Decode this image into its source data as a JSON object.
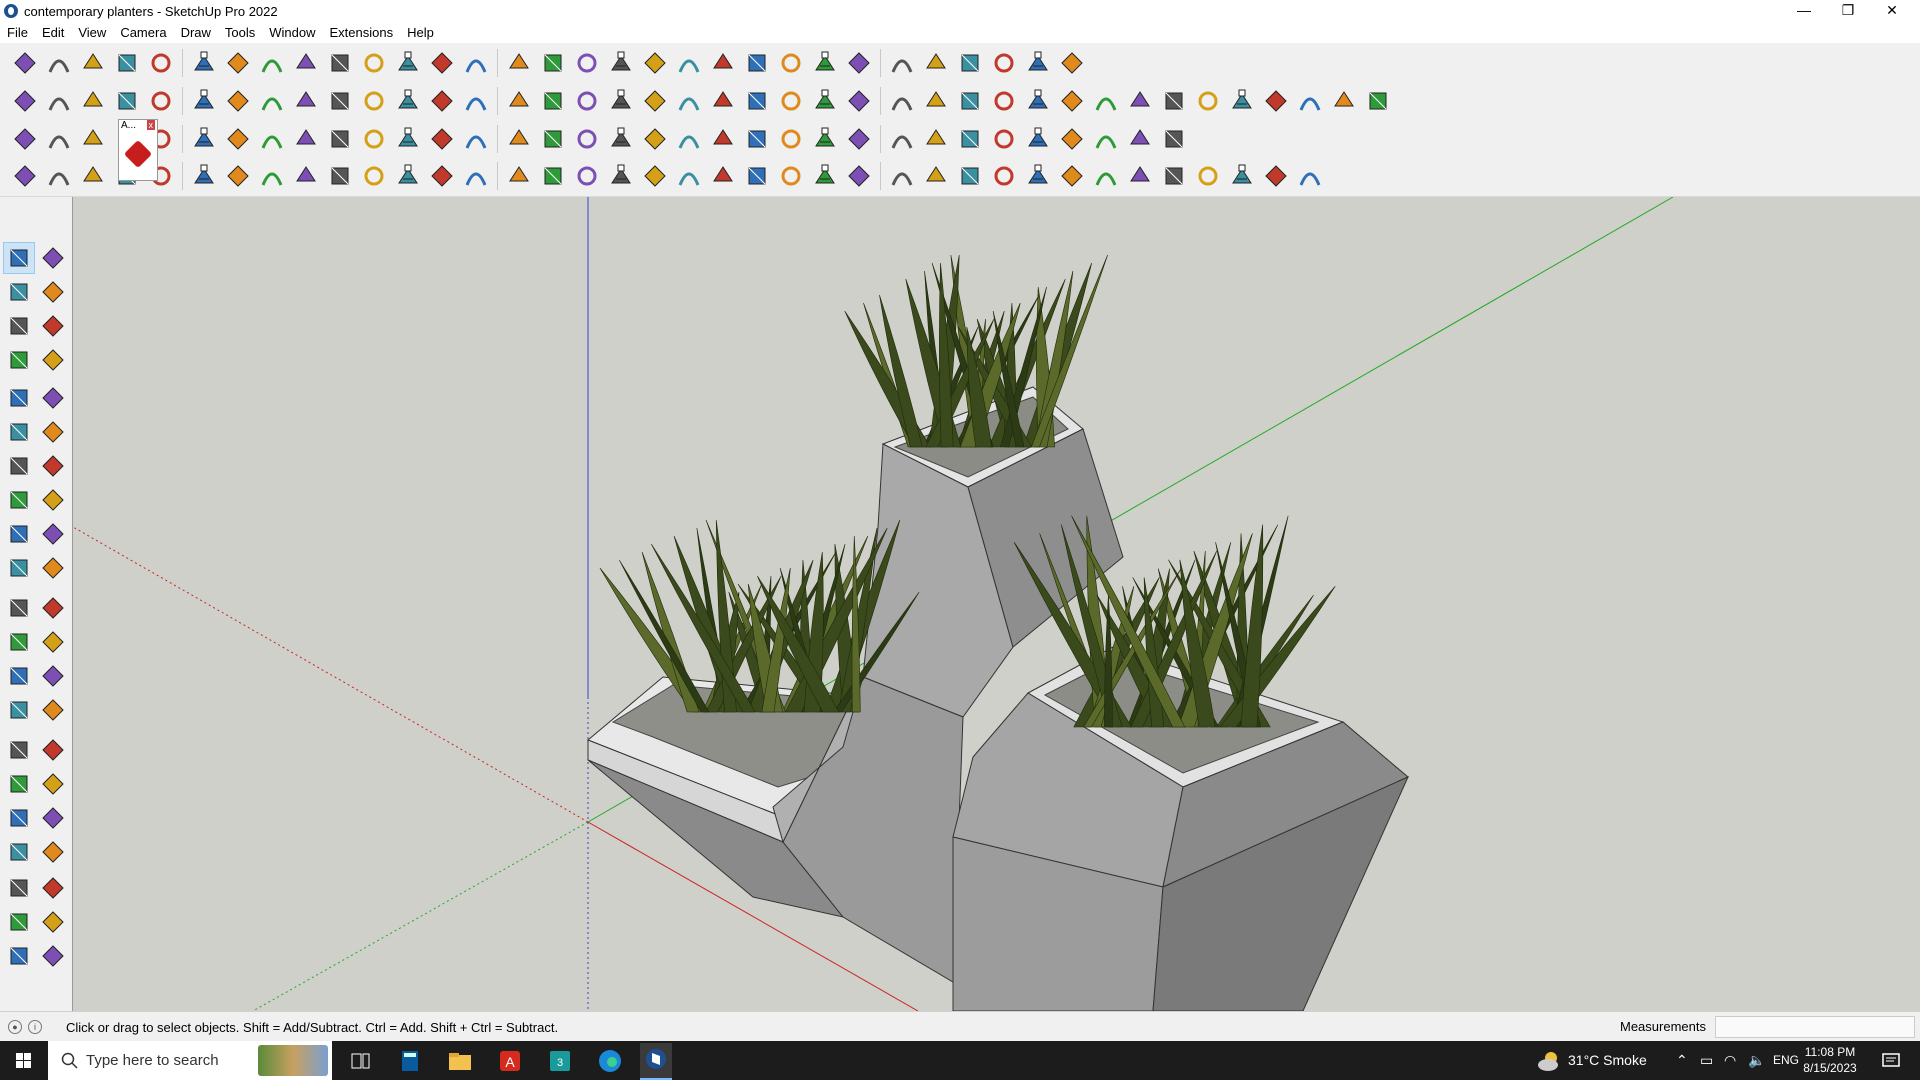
{
  "window": {
    "title": "contemporary planters - SketchUp Pro 2022",
    "minimize": "—",
    "restore": "❐",
    "close": "✕"
  },
  "menu": [
    "File",
    "Edit",
    "View",
    "Camera",
    "Draw",
    "Tools",
    "Window",
    "Extensions",
    "Help"
  ],
  "toolbar_popup": {
    "label": "A...",
    "close": "x"
  },
  "icons": {
    "row1": [
      "zoom-icon",
      "select-icon",
      "eraser-icon",
      "pencil-icon",
      "lasso-icon",
      "rectangle-icon",
      "push-pull-icon",
      "follow-me-icon",
      "move-icon",
      "rotate-icon",
      "scale-icon",
      "tape-measure-icon",
      "text-icon",
      "paint-icon",
      "orbit-icon",
      "pan-icon",
      "zoom-window-icon",
      "zoom-extents-icon",
      "warehouse-icon",
      "layers-icon",
      "styles-icon",
      "components-icon",
      "user-icon",
      "extension-icon",
      "solid-tools-icon",
      "dimension-icon",
      "axes-icon",
      "section-icon",
      "undo-icon",
      "redo-icon",
      "ruby-icon"
    ],
    "row2": [
      "cube-icon",
      "sphere-icon",
      "hex-icon",
      "push-icon",
      "push-down-icon",
      "push-up-icon",
      "push-left-icon",
      "push-right-icon",
      "push-n-icon",
      "push-e-icon",
      "curve-icon",
      "slope-icon",
      "fold-icon",
      "edit-icon",
      "terrain-icon",
      "box-icon",
      "house-a-icon",
      "house-b-icon",
      "house-c-icon",
      "house-d-icon",
      "house-e-icon",
      "fe-icon",
      "tag-icon",
      "brush-icon",
      "circle-icon",
      "polygon-icon",
      "hexagon-icon",
      "ellipse-icon",
      "parallelogram-icon",
      "arc-icon",
      "spiral-icon",
      "diamond-icon",
      "chain-icon",
      "knife-icon",
      "shape-icon",
      "tile-icon",
      "sandbox-icon",
      "stamp-icon",
      "drape-icon",
      "grid-icon"
    ],
    "left": [
      "select-tool-icon",
      "orbit-tool-icon",
      "paint-bucket-icon",
      "eraser-tool-icon",
      "component-icon",
      "tape-tool-icon",
      "line-tool-icon",
      "freehand-icon",
      "rectangle-tool-icon",
      "rotated-rect-icon",
      "circle-tool-icon",
      "polygon-tool-icon",
      "arc-tool-icon",
      "pie-icon",
      "arc3-icon",
      "arc2-icon",
      "move-tool-icon",
      "pushpull-tool-icon",
      "rotate-tool-icon",
      "followme-tool-icon",
      "scale-tool-icon",
      "offset-tool-icon",
      "tape-measure-tool-icon",
      "dimension-tool-icon",
      "protractor-icon",
      "text-tool-icon",
      "axes-tool-icon",
      "3d-text-icon",
      "orbit-view-icon",
      "pan-view-icon",
      "zoom-view-icon",
      "zoom-window-view-icon",
      "zoom-extents-view-icon",
      "previous-view-icon",
      "walk-icon",
      "look-around-icon",
      "position-camera-icon",
      "footprints-icon",
      "section-plane-icon",
      "section-display-icon",
      "warehouse-tool-icon",
      "layers-tool-icon"
    ]
  },
  "status": {
    "hint": "Click or drag to select objects. Shift = Add/Subtract. Ctrl = Add. Shift + Ctrl = Subtract.",
    "measurements_label": "Measurements",
    "measurements_value": ""
  },
  "taskbar": {
    "search_placeholder": "Type here to search",
    "weather": "31°C  Smoke",
    "language": "ENG",
    "time": "11:08 PM",
    "date": "8/15/2023"
  },
  "colors": {
    "viewport_bg": "#d0d0ca",
    "axis_red": "#cc2222",
    "axis_green": "#22aa22",
    "axis_blue": "#3344cc",
    "concrete_light": "#a8a8a8",
    "concrete_dark": "#6f6f6f",
    "concrete_top": "#e4e4e4",
    "leaf_green": "#3b4a1c"
  }
}
